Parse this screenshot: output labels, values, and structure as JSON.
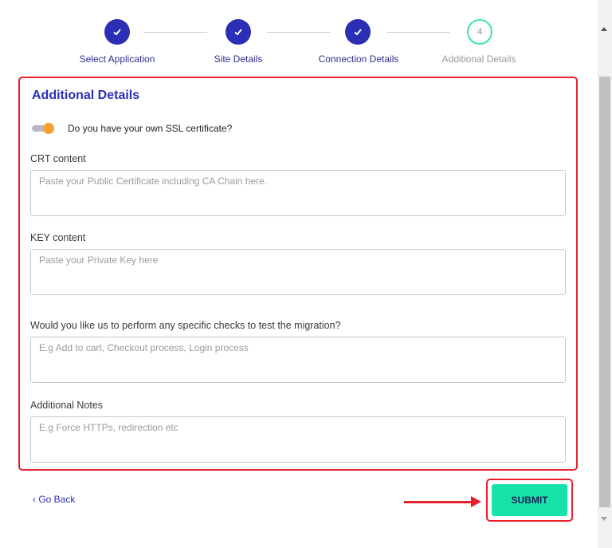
{
  "stepper": {
    "steps": [
      {
        "label": "Select Application",
        "status": "completed"
      },
      {
        "label": "Site Details",
        "status": "completed"
      },
      {
        "label": "Connection Details",
        "status": "completed"
      },
      {
        "label": "Additional Details",
        "status": "current",
        "number": "4"
      }
    ],
    "check_glyph": "✓"
  },
  "form": {
    "title": "Additional Details",
    "ssl_toggle": {
      "label": "Do you have your own SSL certificate?",
      "on": true
    },
    "crt": {
      "label": "CRT content",
      "placeholder": "Paste your Public Certificate including CA Chain here."
    },
    "key": {
      "label": "KEY content",
      "placeholder": "Paste your Private Key here"
    },
    "checks": {
      "label": "Would you like us to perform any specific checks to test the migration?",
      "placeholder": "E.g Add to cart, Checkout process, Login process"
    },
    "notes": {
      "label": "Additional Notes",
      "placeholder": "E.g Force HTTPs, redirection etc"
    }
  },
  "footer": {
    "go_back": "‹ Go Back",
    "submit": "SUBMIT"
  },
  "colors": {
    "accent": "#2b2fb6",
    "submit": "#16e3a9",
    "toggle_on": "#f7a132",
    "highlight": "#e8202a"
  }
}
